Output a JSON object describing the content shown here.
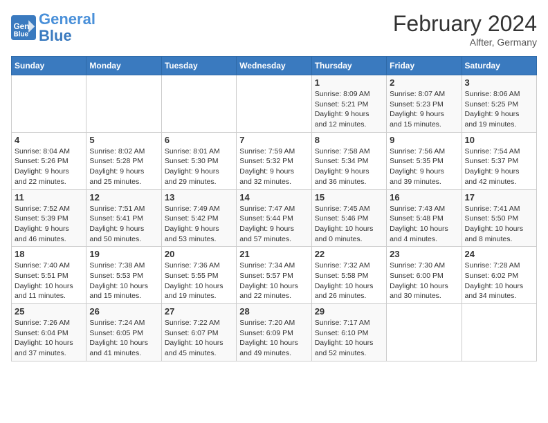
{
  "header": {
    "logo_line1": "General",
    "logo_line2": "Blue",
    "month": "February 2024",
    "location": "Alfter, Germany"
  },
  "days_of_week": [
    "Sunday",
    "Monday",
    "Tuesday",
    "Wednesday",
    "Thursday",
    "Friday",
    "Saturday"
  ],
  "weeks": [
    [
      {
        "day": "",
        "info": ""
      },
      {
        "day": "",
        "info": ""
      },
      {
        "day": "",
        "info": ""
      },
      {
        "day": "",
        "info": ""
      },
      {
        "day": "1",
        "info": "Sunrise: 8:09 AM\nSunset: 5:21 PM\nDaylight: 9 hours\nand 12 minutes."
      },
      {
        "day": "2",
        "info": "Sunrise: 8:07 AM\nSunset: 5:23 PM\nDaylight: 9 hours\nand 15 minutes."
      },
      {
        "day": "3",
        "info": "Sunrise: 8:06 AM\nSunset: 5:25 PM\nDaylight: 9 hours\nand 19 minutes."
      }
    ],
    [
      {
        "day": "4",
        "info": "Sunrise: 8:04 AM\nSunset: 5:26 PM\nDaylight: 9 hours\nand 22 minutes."
      },
      {
        "day": "5",
        "info": "Sunrise: 8:02 AM\nSunset: 5:28 PM\nDaylight: 9 hours\nand 25 minutes."
      },
      {
        "day": "6",
        "info": "Sunrise: 8:01 AM\nSunset: 5:30 PM\nDaylight: 9 hours\nand 29 minutes."
      },
      {
        "day": "7",
        "info": "Sunrise: 7:59 AM\nSunset: 5:32 PM\nDaylight: 9 hours\nand 32 minutes."
      },
      {
        "day": "8",
        "info": "Sunrise: 7:58 AM\nSunset: 5:34 PM\nDaylight: 9 hours\nand 36 minutes."
      },
      {
        "day": "9",
        "info": "Sunrise: 7:56 AM\nSunset: 5:35 PM\nDaylight: 9 hours\nand 39 minutes."
      },
      {
        "day": "10",
        "info": "Sunrise: 7:54 AM\nSunset: 5:37 PM\nDaylight: 9 hours\nand 42 minutes."
      }
    ],
    [
      {
        "day": "11",
        "info": "Sunrise: 7:52 AM\nSunset: 5:39 PM\nDaylight: 9 hours\nand 46 minutes."
      },
      {
        "day": "12",
        "info": "Sunrise: 7:51 AM\nSunset: 5:41 PM\nDaylight: 9 hours\nand 50 minutes."
      },
      {
        "day": "13",
        "info": "Sunrise: 7:49 AM\nSunset: 5:42 PM\nDaylight: 9 hours\nand 53 minutes."
      },
      {
        "day": "14",
        "info": "Sunrise: 7:47 AM\nSunset: 5:44 PM\nDaylight: 9 hours\nand 57 minutes."
      },
      {
        "day": "15",
        "info": "Sunrise: 7:45 AM\nSunset: 5:46 PM\nDaylight: 10 hours\nand 0 minutes."
      },
      {
        "day": "16",
        "info": "Sunrise: 7:43 AM\nSunset: 5:48 PM\nDaylight: 10 hours\nand 4 minutes."
      },
      {
        "day": "17",
        "info": "Sunrise: 7:41 AM\nSunset: 5:50 PM\nDaylight: 10 hours\nand 8 minutes."
      }
    ],
    [
      {
        "day": "18",
        "info": "Sunrise: 7:40 AM\nSunset: 5:51 PM\nDaylight: 10 hours\nand 11 minutes."
      },
      {
        "day": "19",
        "info": "Sunrise: 7:38 AM\nSunset: 5:53 PM\nDaylight: 10 hours\nand 15 minutes."
      },
      {
        "day": "20",
        "info": "Sunrise: 7:36 AM\nSunset: 5:55 PM\nDaylight: 10 hours\nand 19 minutes."
      },
      {
        "day": "21",
        "info": "Sunrise: 7:34 AM\nSunset: 5:57 PM\nDaylight: 10 hours\nand 22 minutes."
      },
      {
        "day": "22",
        "info": "Sunrise: 7:32 AM\nSunset: 5:58 PM\nDaylight: 10 hours\nand 26 minutes."
      },
      {
        "day": "23",
        "info": "Sunrise: 7:30 AM\nSunset: 6:00 PM\nDaylight: 10 hours\nand 30 minutes."
      },
      {
        "day": "24",
        "info": "Sunrise: 7:28 AM\nSunset: 6:02 PM\nDaylight: 10 hours\nand 34 minutes."
      }
    ],
    [
      {
        "day": "25",
        "info": "Sunrise: 7:26 AM\nSunset: 6:04 PM\nDaylight: 10 hours\nand 37 minutes."
      },
      {
        "day": "26",
        "info": "Sunrise: 7:24 AM\nSunset: 6:05 PM\nDaylight: 10 hours\nand 41 minutes."
      },
      {
        "day": "27",
        "info": "Sunrise: 7:22 AM\nSunset: 6:07 PM\nDaylight: 10 hours\nand 45 minutes."
      },
      {
        "day": "28",
        "info": "Sunrise: 7:20 AM\nSunset: 6:09 PM\nDaylight: 10 hours\nand 49 minutes."
      },
      {
        "day": "29",
        "info": "Sunrise: 7:17 AM\nSunset: 6:10 PM\nDaylight: 10 hours\nand 52 minutes."
      },
      {
        "day": "",
        "info": ""
      },
      {
        "day": "",
        "info": ""
      }
    ]
  ]
}
